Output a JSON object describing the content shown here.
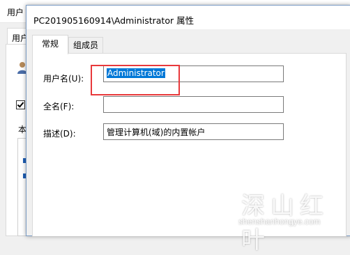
{
  "background_window": {
    "title": "用户",
    "tab_label": "用户",
    "section_label": "本"
  },
  "dialog": {
    "title": "PC201905160914\\Administrator 属性",
    "tabs": [
      {
        "label": "常规",
        "active": true
      },
      {
        "label": "组成员",
        "active": false
      }
    ],
    "fields": {
      "username": {
        "label": "用户名(U):",
        "value": "Administrator",
        "selected": true
      },
      "fullname": {
        "label": "全名(F):",
        "value": ""
      },
      "description": {
        "label": "描述(D):",
        "value": "管理计算机(域)的内置帐户"
      }
    }
  },
  "annotation": {
    "color": "#e8393b"
  },
  "watermark": {
    "main": "深山红叶",
    "sub": "shenshanhongye.com"
  },
  "colors": {
    "selection": "#0078d7",
    "dialog_border": "#7a9bc4"
  }
}
